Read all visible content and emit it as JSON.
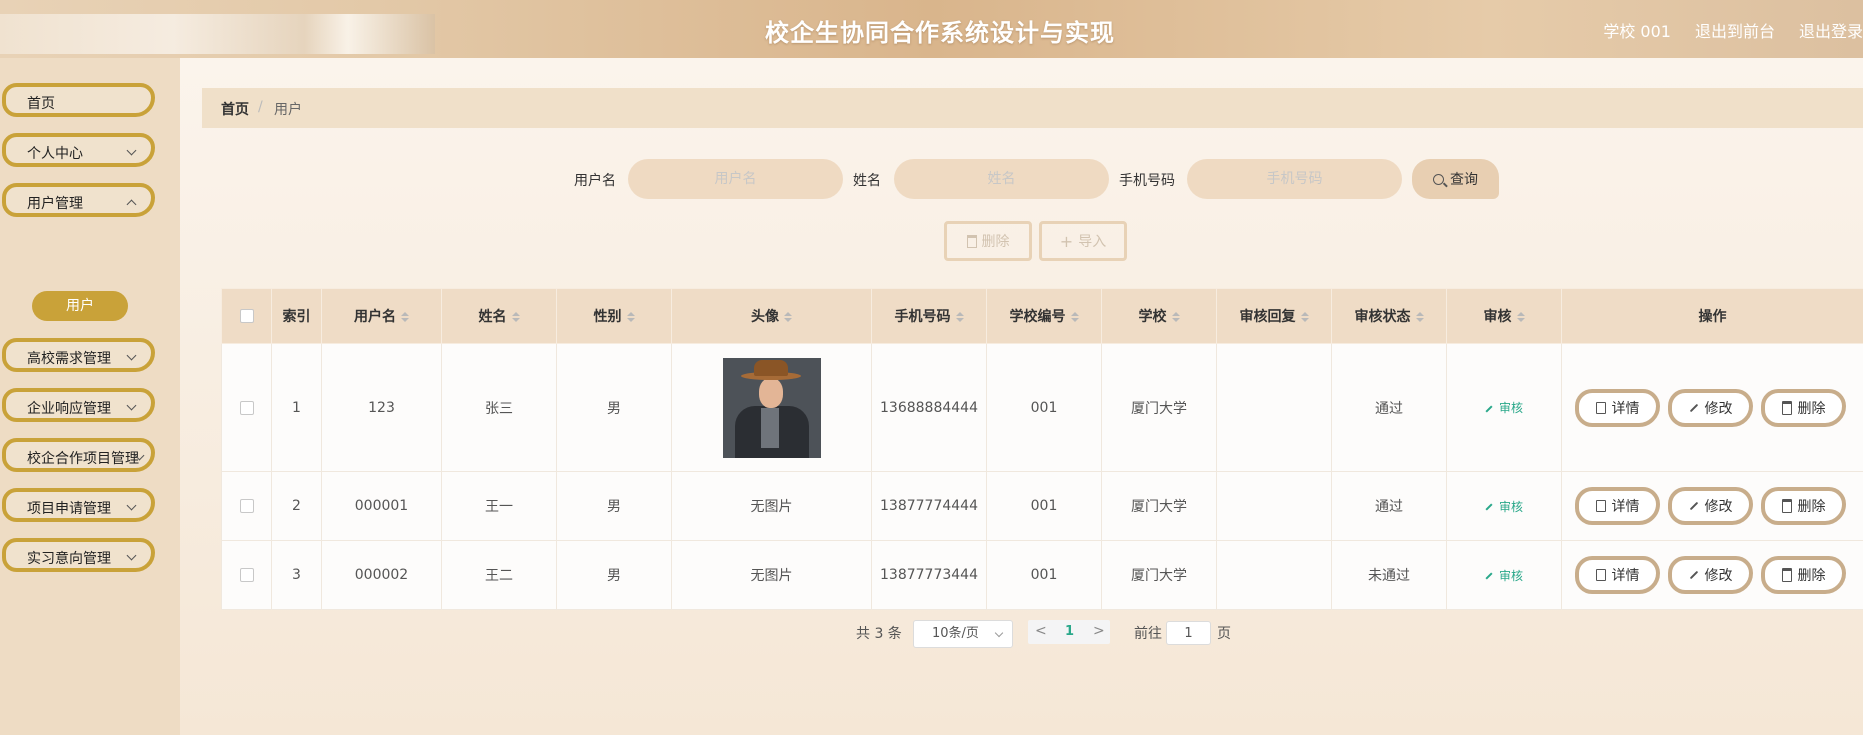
{
  "header": {
    "title": "校企生协同合作系统设计与实现",
    "user": "学校 001",
    "front_link": "退出到前台",
    "logout": "退出登录"
  },
  "sidebar": {
    "items": [
      {
        "label": "首页"
      },
      {
        "label": "个人中心"
      },
      {
        "label": "用户管理"
      },
      {
        "label": "高校需求管理"
      },
      {
        "label": "企业响应管理"
      },
      {
        "label": "校企合作项目管理"
      },
      {
        "label": "项目申请管理"
      },
      {
        "label": "实习意向管理"
      }
    ],
    "active_sub": "用户"
  },
  "breadcrumb": {
    "home": "首页",
    "separator": "/",
    "current": "用户"
  },
  "search": {
    "username_label": "用户名",
    "username_placeholder": "用户名",
    "name_label": "姓名",
    "name_placeholder": "姓名",
    "phone_label": "手机号码",
    "phone_placeholder": "手机号码",
    "query_button": "查询"
  },
  "actions": {
    "delete": "删除",
    "import": "导入"
  },
  "table": {
    "headers": {
      "index": "索引",
      "username": "用户名",
      "name": "姓名",
      "gender": "性别",
      "avatar": "头像",
      "phone": "手机号码",
      "school_no": "学校编号",
      "school": "学校",
      "reply": "审核回复",
      "status": "审核状态",
      "audit": "审核",
      "operation": "操作"
    },
    "rows": [
      {
        "index": "1",
        "username": "123",
        "name": "张三",
        "gender": "男",
        "avatar": "",
        "phone": "13688884444",
        "school_no": "001",
        "school": "厦门大学",
        "reply": "",
        "status": "通过",
        "audit": "审核"
      },
      {
        "index": "2",
        "username": "000001",
        "name": "王一",
        "gender": "男",
        "avatar": "无图片",
        "phone": "13877774444",
        "school_no": "001",
        "school": "厦门大学",
        "reply": "",
        "status": "通过",
        "audit": "审核"
      },
      {
        "index": "3",
        "username": "000002",
        "name": "王二",
        "gender": "男",
        "avatar": "无图片",
        "phone": "13877773444",
        "school_no": "001",
        "school": "厦门大学",
        "reply": "",
        "status": "未通过",
        "audit": "审核"
      }
    ],
    "row_buttons": {
      "detail": "详情",
      "edit": "修改",
      "delete": "删除"
    }
  },
  "pagination": {
    "total": "共 3 条",
    "page_size": "10条/页",
    "prev": "<",
    "current_page": "1",
    "next": ">",
    "goto_label": "前往",
    "goto_value": "1",
    "page_suffix": "页"
  }
}
